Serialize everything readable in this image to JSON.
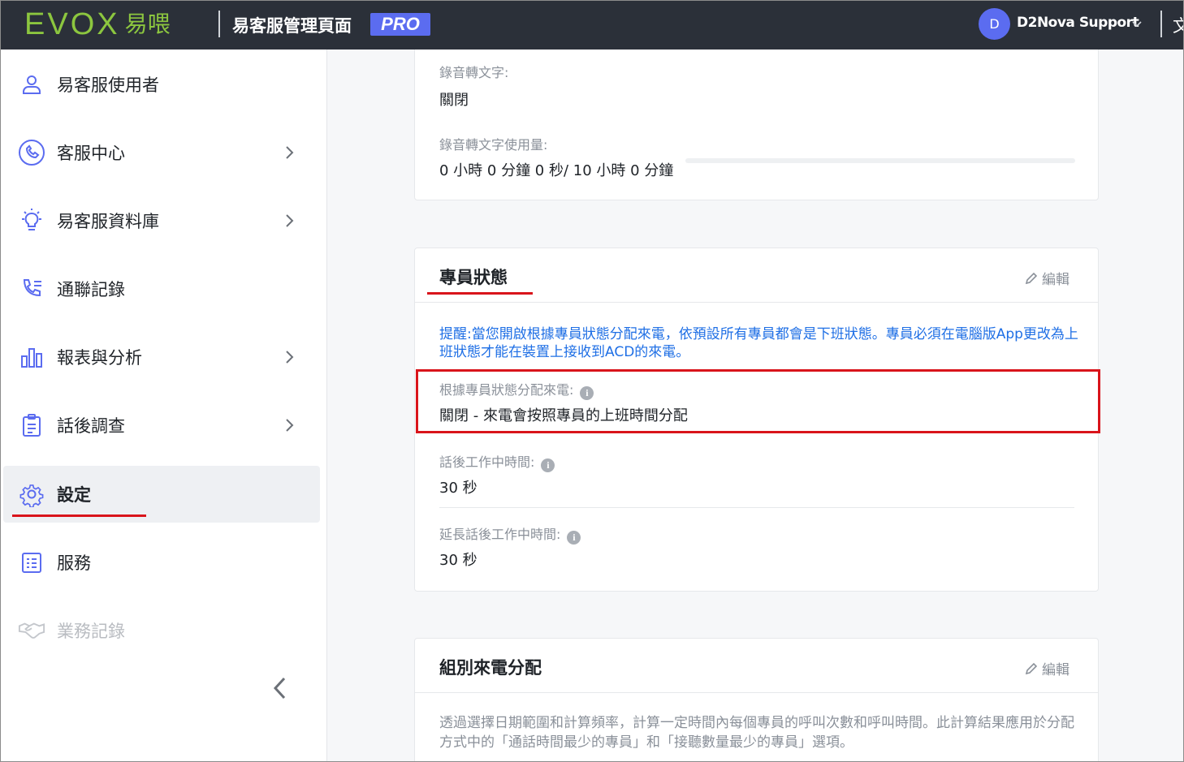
{
  "header": {
    "logo_text": "EVOX",
    "logo_cn": "易喂",
    "title": "易客服管理頁面",
    "badge": "PRO",
    "user_initial": "D",
    "user_name": "D2Nova Support",
    "lang_glyph": "文"
  },
  "sidebar": {
    "items": [
      {
        "label": "易客服使用者",
        "icon": "user-icon"
      },
      {
        "label": "客服中心",
        "icon": "headset-icon"
      },
      {
        "label": "易客服資料庫",
        "icon": "lightbulb-icon"
      },
      {
        "label": "通聯記錄",
        "icon": "phone-log-icon"
      },
      {
        "label": "報表與分析",
        "icon": "bar-chart-icon"
      },
      {
        "label": "話後調查",
        "icon": "clipboard-icon"
      },
      {
        "label": "設定",
        "icon": "gear-icon"
      },
      {
        "label": "服務",
        "icon": "list-icon"
      },
      {
        "label": "業務記錄",
        "icon": "handshake-icon"
      }
    ],
    "active_item": "設定"
  },
  "recording_card": {
    "stt_label": "錄音轉文字:",
    "stt_value": "關閉",
    "usage_label": "錄音轉文字使用量:",
    "usage_value": "0 小時 0 分鐘 0 秒/ 10 小時 0 分鐘",
    "usage_fraction": 0
  },
  "agent_status_card": {
    "title": "專員狀態",
    "edit_label": "編輯",
    "notice": "提醒:當您開啟根據專員狀態分配來電，依預設所有專員都會是下班狀態。專員必須在電腦版App更改為上班狀態才能在裝置上接收到ACD的來電。",
    "fields": [
      {
        "label": "根據專員狀態分配來電:",
        "value": "關閉 - 來電會按照專員的上班時間分配"
      },
      {
        "label": "話後工作中時間:",
        "value": "30 秒"
      },
      {
        "label": "延長話後工作中時間:",
        "value": "30 秒"
      }
    ]
  },
  "group_routing_card": {
    "title": "組別來電分配",
    "edit_label": "編輯",
    "description": "透過選擇日期範圍和計算頻率，計算一定時間內每個專員的呼叫次數和呼叫時間。此計算結果應用於分配方式中的「通話時間最少的專員」和「接聽數量最少的專員」選項。"
  }
}
